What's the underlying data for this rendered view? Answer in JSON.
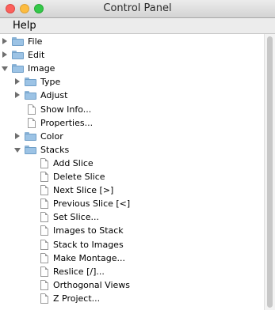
{
  "window": {
    "title": "Control Panel"
  },
  "menubar": {
    "help_label": "Help"
  },
  "tree": {
    "items": [
      {
        "label": "File",
        "kind": "folder",
        "level": 0,
        "expanded": false
      },
      {
        "label": "Edit",
        "kind": "folder",
        "level": 0,
        "expanded": false
      },
      {
        "label": "Image",
        "kind": "folder",
        "level": 0,
        "expanded": true
      },
      {
        "label": "Type",
        "kind": "folder",
        "level": 1,
        "expanded": false
      },
      {
        "label": "Adjust",
        "kind": "folder",
        "level": 1,
        "expanded": false
      },
      {
        "label": "Show Info...",
        "kind": "item",
        "level": 1
      },
      {
        "label": "Properties...",
        "kind": "item",
        "level": 1
      },
      {
        "label": "Color",
        "kind": "folder",
        "level": 1,
        "expanded": false
      },
      {
        "label": "Stacks",
        "kind": "folder",
        "level": 1,
        "expanded": true
      },
      {
        "label": "Add Slice",
        "kind": "item",
        "level": 2
      },
      {
        "label": "Delete Slice",
        "kind": "item",
        "level": 2
      },
      {
        "label": "Next Slice [>]",
        "kind": "item",
        "level": 2
      },
      {
        "label": "Previous Slice [<]",
        "kind": "item",
        "level": 2
      },
      {
        "label": "Set Slice...",
        "kind": "item",
        "level": 2
      },
      {
        "label": "Images to Stack",
        "kind": "item",
        "level": 2
      },
      {
        "label": "Stack to Images",
        "kind": "item",
        "level": 2
      },
      {
        "label": "Make Montage...",
        "kind": "item",
        "level": 2
      },
      {
        "label": "Reslice [/]...",
        "kind": "item",
        "level": 2
      },
      {
        "label": "Orthogonal Views",
        "kind": "item",
        "level": 2
      },
      {
        "label": "Z Project...",
        "kind": "item",
        "level": 2
      }
    ]
  }
}
